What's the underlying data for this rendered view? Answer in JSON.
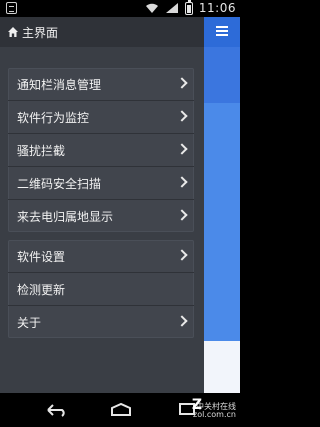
{
  "status": {
    "time": "11:06"
  },
  "drawer": {
    "title": "主界面",
    "groups": [
      {
        "items": [
          {
            "label": "通知栏消息管理",
            "has_arrow": true
          },
          {
            "label": "软件行为监控",
            "has_arrow": true
          },
          {
            "label": "骚扰拦截",
            "has_arrow": true
          },
          {
            "label": "二维码安全扫描",
            "has_arrow": true
          },
          {
            "label": "来去电归属地显示",
            "has_arrow": true
          }
        ]
      },
      {
        "items": [
          {
            "label": "软件设置",
            "has_arrow": true
          },
          {
            "label": "检测更新",
            "has_arrow": false
          },
          {
            "label": "关于",
            "has_arrow": true
          }
        ]
      }
    ]
  },
  "colors": {
    "drawer_bg": "#3a3e45",
    "header_bg": "#2f3238",
    "accent_blue": "#2d6bd8"
  },
  "watermark": {
    "brand": "中关村在线",
    "site": "zol.com.cn"
  }
}
